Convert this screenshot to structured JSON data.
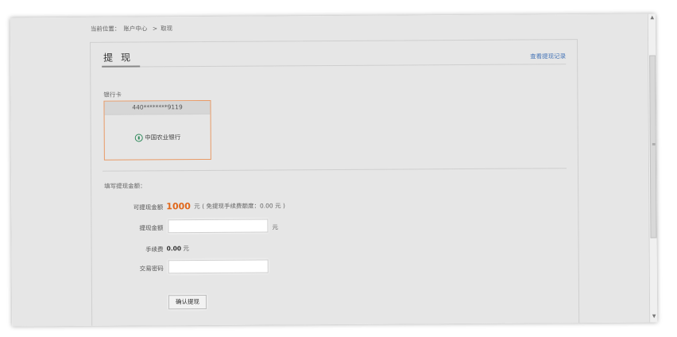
{
  "breadcrumb": {
    "label": "当前位置：",
    "home": "账户中心",
    "separator": ">",
    "current": "取现"
  },
  "panel": {
    "title": "提现",
    "history_link": "查看提现记录"
  },
  "bank_section": {
    "label": "银行卡",
    "card": {
      "number": "440********9119",
      "bank_name": "中国农业银行",
      "bank_icon": "agricultural-bank-logo-icon"
    }
  },
  "form": {
    "section_label": "填写提现金额：",
    "available": {
      "label": "可提现金额",
      "amount": "1000",
      "unit": "元",
      "note": "( 免提现手续费额度：0.00 元 )"
    },
    "withdraw_amount": {
      "label": "提现金额",
      "value": "",
      "placeholder": "",
      "unit": "元"
    },
    "fee": {
      "label": "手续费",
      "value": "0.00",
      "unit": "元"
    },
    "password": {
      "label": "交易密码",
      "value": "",
      "placeholder": ""
    },
    "submit_label": "确认提现"
  },
  "colors": {
    "accent_orange": "#e0681c",
    "card_border": "#e89a66",
    "link_blue": "#4a78b8",
    "page_bg": "#e6e6e6"
  }
}
